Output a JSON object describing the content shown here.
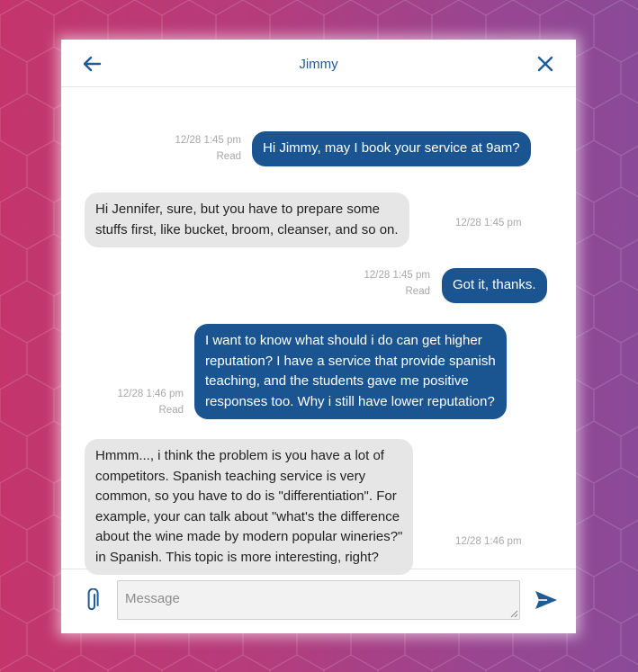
{
  "header": {
    "title": "Jimmy"
  },
  "messages": [
    {
      "direction": "out",
      "lines": [
        "Hi Jimmy, may I book your service at 9am?"
      ],
      "time": "12/28 1:45 pm",
      "status": "Read"
    },
    {
      "direction": "in",
      "lines": [
        "Hi Jennifer, sure, but you have to prepare some",
        "stuffs first, like bucket, broom, cleanser, and so on."
      ],
      "time": "12/28 1:45 pm"
    },
    {
      "direction": "out",
      "lines": [
        "Got it, thanks."
      ],
      "time": "12/28 1:45 pm",
      "status": "Read"
    },
    {
      "direction": "out",
      "lines": [
        "I want to know what should i do can get higher",
        "reputation? I have a service that provide spanish",
        "teaching, and the students gave me positive",
        "responses too. Why i still have lower reputation?"
      ],
      "time": "12/28 1:46 pm",
      "status": "Read"
    },
    {
      "direction": "in",
      "lines": [
        "Hmmm..., i think the problem is you have a lot of",
        "competitors. Spanish teaching service is very",
        "common, so you have to do is \"differentiation\". For",
        "example, your can talk about \"what's the difference",
        "about the wine made by modern popular wineries?\"",
        "in Spanish. This topic is more interesting, right?"
      ],
      "time": "12/28 1:46 pm"
    }
  ],
  "composer": {
    "placeholder": "Message"
  },
  "icons": {
    "back": "arrow-left-icon",
    "close": "close-icon",
    "attach": "paperclip-icon",
    "send": "send-icon"
  },
  "colors": {
    "accent": "#1b5591",
    "incoming_bubble": "#e6e6e6",
    "meta_text": "#a8a8a8"
  }
}
